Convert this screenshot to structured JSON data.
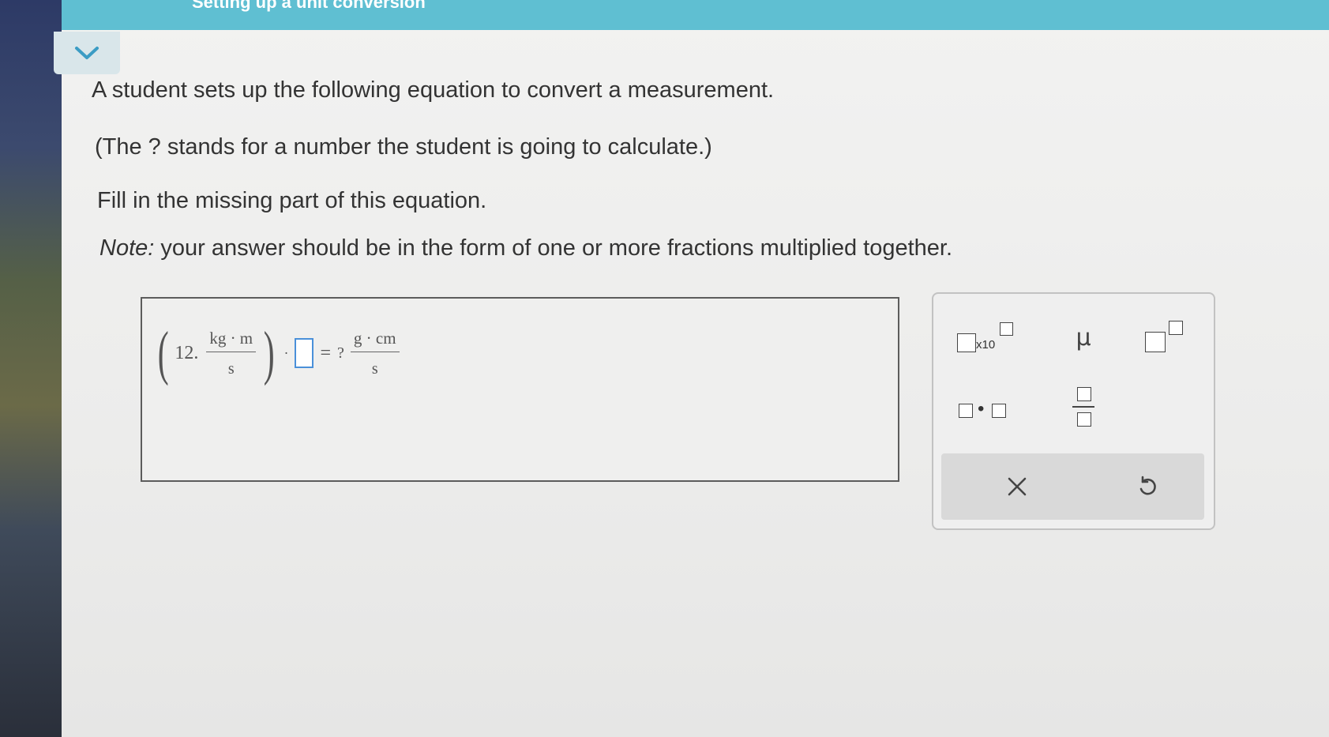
{
  "header": {
    "title": "Setting up a unit conversion"
  },
  "question": {
    "line1": "A student sets up the following equation to convert a measurement.",
    "line2": "(The ? stands for a number the student is going to calculate.)",
    "line3": "Fill in the missing part of this equation.",
    "note_label": "Note:",
    "note_text": " your answer should be in the form of one or more fractions multiplied together."
  },
  "equation": {
    "coefficient": "12.",
    "left_numerator": "kg · m",
    "left_denominator": "s",
    "dot": "·",
    "equals": "=",
    "unknown": "?",
    "right_numerator": "g · cm",
    "right_denominator": "s"
  },
  "palette": {
    "sci_label": "x10",
    "mu_label": "μ",
    "mult_dot": "•"
  },
  "icons": {
    "collapse": "chevron-down-icon",
    "clear": "close-icon",
    "undo": "undo-icon"
  },
  "colors": {
    "header": "#5fbfd2",
    "answer_slot_border": "#4a90d9"
  }
}
